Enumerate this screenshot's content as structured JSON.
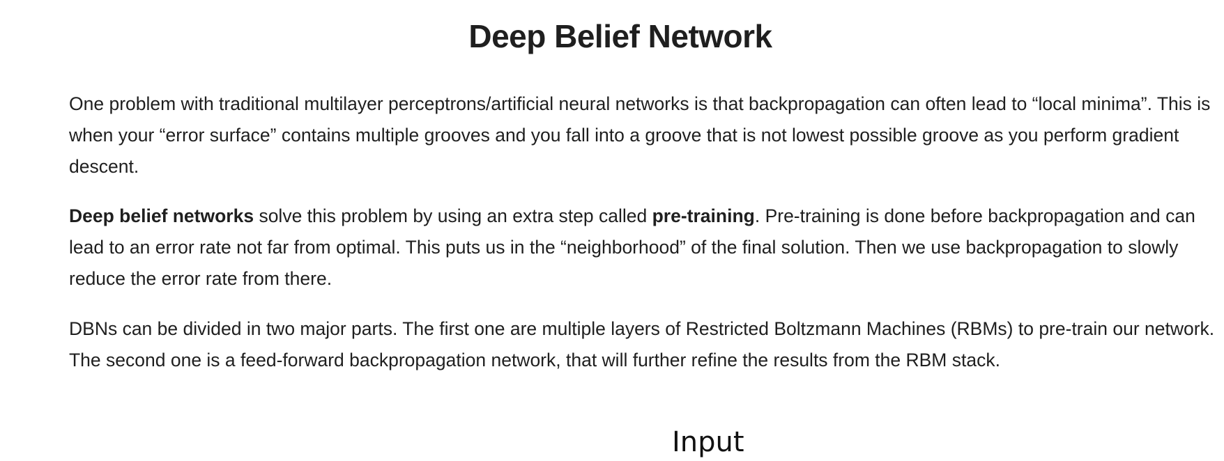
{
  "title": "Deep Belief Network",
  "paragraphs": [
    {
      "text": "One problem with traditional multilayer perceptrons/artificial neural networks is that backpropagation can often lead to “local minima”. This is when your “error surface” contains multiple grooves and you fall into a groove that is not lowest possible groove as you perform gradient descent."
    },
    {
      "bold1": "Deep belief networks",
      "mid1": " solve this problem by using an extra step called ",
      "bold2": "pre-training",
      "rest": ". Pre-training is done before backpropagation and can lead to an error rate not far from optimal. This puts us in the “neighborhood” of the final solution. Then we use backpropagation to slowly reduce the error rate from there."
    },
    {
      "text": "DBNs can be divided in two major parts. The first one are multiple layers of Restricted Boltzmann Machines (RBMs) to pre-train our network. The second one is a feed-forward backpropagation network, that will further refine the results from the RBM stack."
    }
  ],
  "diagram": {
    "label": "Input"
  }
}
